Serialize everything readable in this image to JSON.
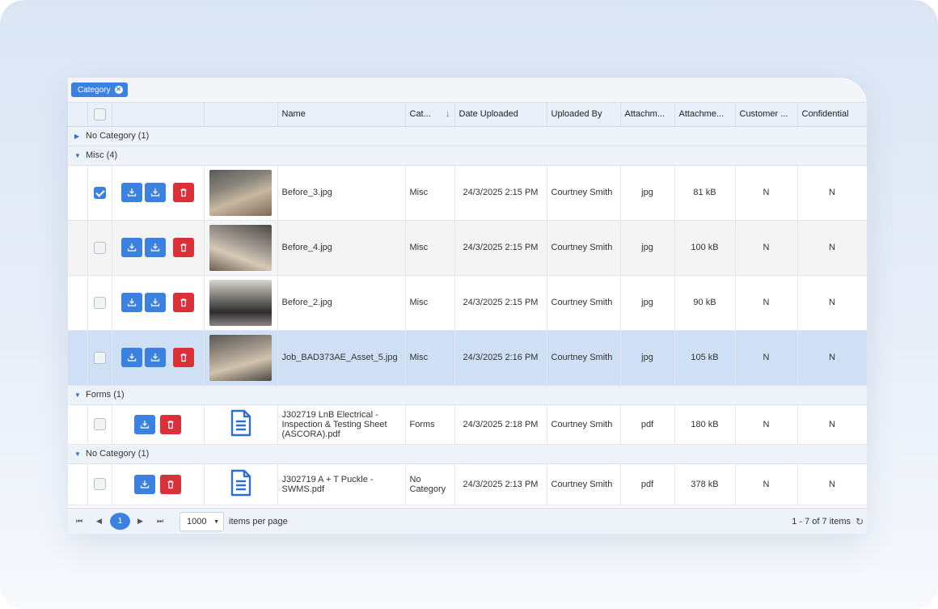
{
  "grouping_chip": {
    "label": "Category"
  },
  "columns": [
    "",
    "",
    "",
    "Name",
    "Cat...",
    "Date Uploaded",
    "Uploaded By",
    "Attachm...",
    "Attachme...",
    "Customer ...",
    "Confidential"
  ],
  "groups": [
    {
      "label": "No Category (1)",
      "expanded": false
    },
    {
      "label": "Misc (4)",
      "expanded": true
    },
    {
      "label": "Forms (1)",
      "expanded": true
    },
    {
      "label": "No Category (1)",
      "expanded": true
    }
  ],
  "rows": [
    {
      "name": "Before_3.jpg",
      "category": "Misc",
      "date": "24/3/2025 2:15 PM",
      "uploaded_by": "Courtney Smith",
      "type": "jpg",
      "size": "81 kB",
      "customer": "N",
      "confidential": "N",
      "checked": true
    },
    {
      "name": "Before_4.jpg",
      "category": "Misc",
      "date": "24/3/2025 2:15 PM",
      "uploaded_by": "Courtney Smith",
      "type": "jpg",
      "size": "100 kB",
      "customer": "N",
      "confidential": "N",
      "checked": false
    },
    {
      "name": "Before_2.jpg",
      "category": "Misc",
      "date": "24/3/2025 2:15 PM",
      "uploaded_by": "Courtney Smith",
      "type": "jpg",
      "size": "90 kB",
      "customer": "N",
      "confidential": "N",
      "checked": false
    },
    {
      "name": "Job_BAD373AE_Asset_5.jpg",
      "category": "Misc",
      "date": "24/3/2025 2:16 PM",
      "uploaded_by": "Courtney Smith",
      "type": "jpg",
      "size": "105 kB",
      "customer": "N",
      "confidential": "N",
      "checked": false
    },
    {
      "name": "J302719 LnB Electrical - Inspection & Testing Sheet (ASCORA).pdf",
      "category": "Forms",
      "date": "24/3/2025 2:18 PM",
      "uploaded_by": "Courtney Smith",
      "type": "pdf",
      "size": "180 kB",
      "customer": "N",
      "confidential": "N",
      "checked": false
    },
    {
      "name": "J302719 A + T Puckle - SWMS.pdf",
      "category": "No Category",
      "date": "24/3/2025 2:13 PM",
      "uploaded_by": "Courtney Smith",
      "type": "pdf",
      "size": "378 kB",
      "customer": "N",
      "confidential": "N",
      "checked": false
    }
  ],
  "pager": {
    "current_page": "1",
    "items_per_page": "1000",
    "items_per_page_label": "items per page",
    "summary": "1 - 7 of 7 items"
  },
  "icons": {
    "download": "download-icon",
    "delete": "trash-icon",
    "document": "document-icon",
    "refresh": "refresh-icon"
  },
  "colors": {
    "accent": "#3b82e0",
    "danger": "#d9303a",
    "selected_row": "#cfe0f6"
  }
}
